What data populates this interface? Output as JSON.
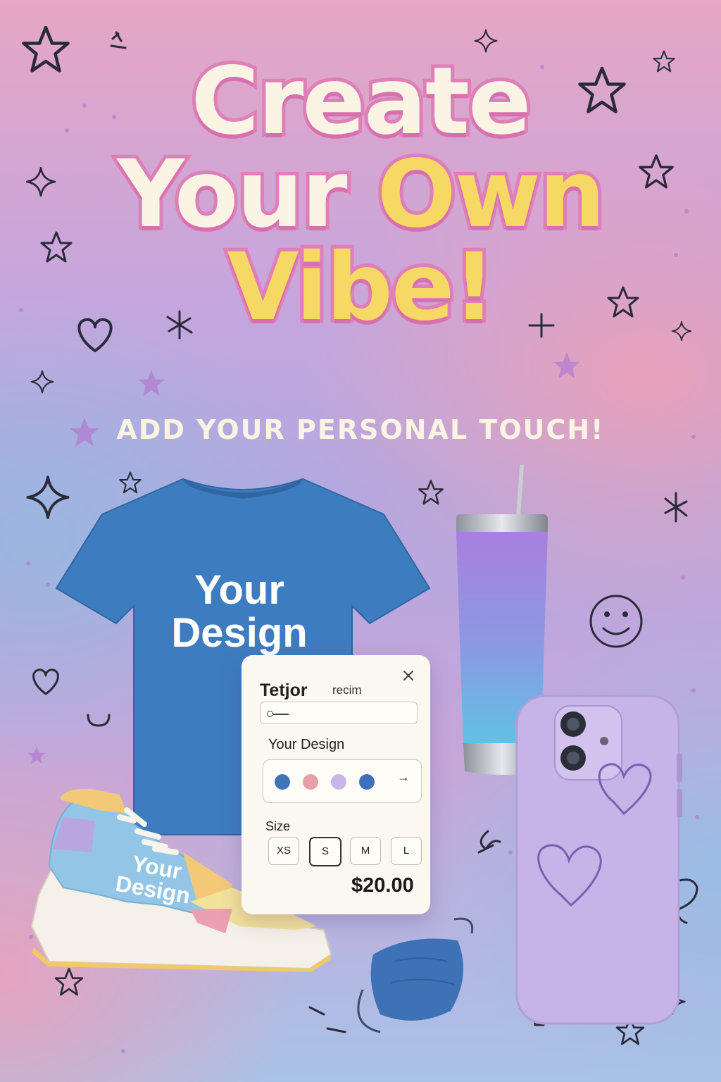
{
  "headline": {
    "line1": "Create",
    "line2a": "Your",
    "line2b": "Own",
    "line3": "Vibe!"
  },
  "subtitle": "ADD YOUR PERSONAL TOUCH!",
  "products": {
    "tshirt_print": "Your\nDesign",
    "sneaker_print": "Your\nDesign"
  },
  "card": {
    "title": "Tetjor",
    "title_suffix": "recim",
    "design_label": "Your Design",
    "swatches": [
      "#3f74b8",
      "#e8a0a8",
      "#c7b6e6",
      "#3f6fbf"
    ],
    "size_label": "Size",
    "sizes": [
      "XS",
      "S",
      "M",
      "L"
    ],
    "selected_size": "S",
    "price": "$20.00"
  },
  "colors": {
    "headline_cream": "#fbf3e4",
    "headline_yellow": "#f6d865",
    "headline_outline": "#df7fb8",
    "tshirt": "#3e7cc0",
    "phone_case": "#c6b3e8"
  },
  "icons": [
    "star-icon",
    "sparkle-icon",
    "heart-icon",
    "smiley-icon",
    "arrow-cursor-icon",
    "close-icon",
    "arrow-right-icon"
  ]
}
